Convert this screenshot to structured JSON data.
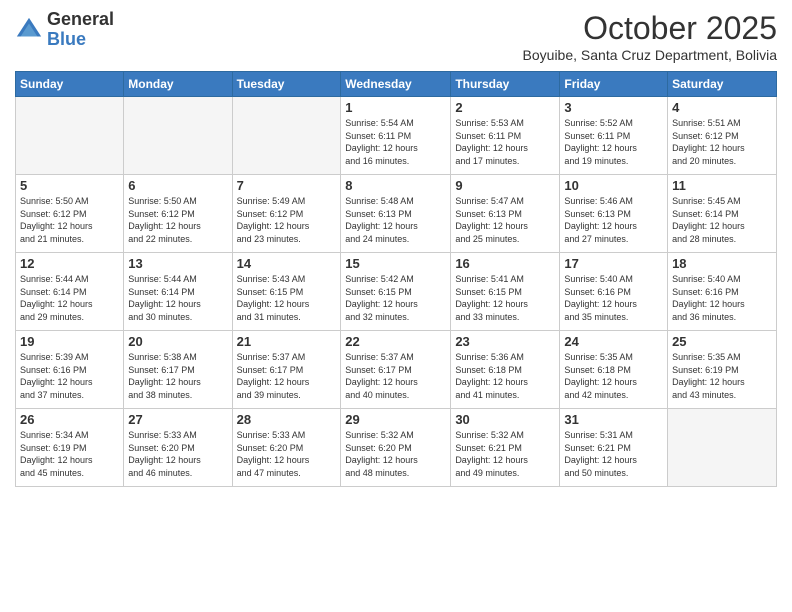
{
  "logo": {
    "general": "General",
    "blue": "Blue"
  },
  "header": {
    "month": "October 2025",
    "location": "Boyuibe, Santa Cruz Department, Bolivia"
  },
  "weekdays": [
    "Sunday",
    "Monday",
    "Tuesday",
    "Wednesday",
    "Thursday",
    "Friday",
    "Saturday"
  ],
  "weeks": [
    [
      {
        "day": "",
        "info": ""
      },
      {
        "day": "",
        "info": ""
      },
      {
        "day": "",
        "info": ""
      },
      {
        "day": "1",
        "info": "Sunrise: 5:54 AM\nSunset: 6:11 PM\nDaylight: 12 hours\nand 16 minutes."
      },
      {
        "day": "2",
        "info": "Sunrise: 5:53 AM\nSunset: 6:11 PM\nDaylight: 12 hours\nand 17 minutes."
      },
      {
        "day": "3",
        "info": "Sunrise: 5:52 AM\nSunset: 6:11 PM\nDaylight: 12 hours\nand 19 minutes."
      },
      {
        "day": "4",
        "info": "Sunrise: 5:51 AM\nSunset: 6:12 PM\nDaylight: 12 hours\nand 20 minutes."
      }
    ],
    [
      {
        "day": "5",
        "info": "Sunrise: 5:50 AM\nSunset: 6:12 PM\nDaylight: 12 hours\nand 21 minutes."
      },
      {
        "day": "6",
        "info": "Sunrise: 5:50 AM\nSunset: 6:12 PM\nDaylight: 12 hours\nand 22 minutes."
      },
      {
        "day": "7",
        "info": "Sunrise: 5:49 AM\nSunset: 6:12 PM\nDaylight: 12 hours\nand 23 minutes."
      },
      {
        "day": "8",
        "info": "Sunrise: 5:48 AM\nSunset: 6:13 PM\nDaylight: 12 hours\nand 24 minutes."
      },
      {
        "day": "9",
        "info": "Sunrise: 5:47 AM\nSunset: 6:13 PM\nDaylight: 12 hours\nand 25 minutes."
      },
      {
        "day": "10",
        "info": "Sunrise: 5:46 AM\nSunset: 6:13 PM\nDaylight: 12 hours\nand 27 minutes."
      },
      {
        "day": "11",
        "info": "Sunrise: 5:45 AM\nSunset: 6:14 PM\nDaylight: 12 hours\nand 28 minutes."
      }
    ],
    [
      {
        "day": "12",
        "info": "Sunrise: 5:44 AM\nSunset: 6:14 PM\nDaylight: 12 hours\nand 29 minutes."
      },
      {
        "day": "13",
        "info": "Sunrise: 5:44 AM\nSunset: 6:14 PM\nDaylight: 12 hours\nand 30 minutes."
      },
      {
        "day": "14",
        "info": "Sunrise: 5:43 AM\nSunset: 6:15 PM\nDaylight: 12 hours\nand 31 minutes."
      },
      {
        "day": "15",
        "info": "Sunrise: 5:42 AM\nSunset: 6:15 PM\nDaylight: 12 hours\nand 32 minutes."
      },
      {
        "day": "16",
        "info": "Sunrise: 5:41 AM\nSunset: 6:15 PM\nDaylight: 12 hours\nand 33 minutes."
      },
      {
        "day": "17",
        "info": "Sunrise: 5:40 AM\nSunset: 6:16 PM\nDaylight: 12 hours\nand 35 minutes."
      },
      {
        "day": "18",
        "info": "Sunrise: 5:40 AM\nSunset: 6:16 PM\nDaylight: 12 hours\nand 36 minutes."
      }
    ],
    [
      {
        "day": "19",
        "info": "Sunrise: 5:39 AM\nSunset: 6:16 PM\nDaylight: 12 hours\nand 37 minutes."
      },
      {
        "day": "20",
        "info": "Sunrise: 5:38 AM\nSunset: 6:17 PM\nDaylight: 12 hours\nand 38 minutes."
      },
      {
        "day": "21",
        "info": "Sunrise: 5:37 AM\nSunset: 6:17 PM\nDaylight: 12 hours\nand 39 minutes."
      },
      {
        "day": "22",
        "info": "Sunrise: 5:37 AM\nSunset: 6:17 PM\nDaylight: 12 hours\nand 40 minutes."
      },
      {
        "day": "23",
        "info": "Sunrise: 5:36 AM\nSunset: 6:18 PM\nDaylight: 12 hours\nand 41 minutes."
      },
      {
        "day": "24",
        "info": "Sunrise: 5:35 AM\nSunset: 6:18 PM\nDaylight: 12 hours\nand 42 minutes."
      },
      {
        "day": "25",
        "info": "Sunrise: 5:35 AM\nSunset: 6:19 PM\nDaylight: 12 hours\nand 43 minutes."
      }
    ],
    [
      {
        "day": "26",
        "info": "Sunrise: 5:34 AM\nSunset: 6:19 PM\nDaylight: 12 hours\nand 45 minutes."
      },
      {
        "day": "27",
        "info": "Sunrise: 5:33 AM\nSunset: 6:20 PM\nDaylight: 12 hours\nand 46 minutes."
      },
      {
        "day": "28",
        "info": "Sunrise: 5:33 AM\nSunset: 6:20 PM\nDaylight: 12 hours\nand 47 minutes."
      },
      {
        "day": "29",
        "info": "Sunrise: 5:32 AM\nSunset: 6:20 PM\nDaylight: 12 hours\nand 48 minutes."
      },
      {
        "day": "30",
        "info": "Sunrise: 5:32 AM\nSunset: 6:21 PM\nDaylight: 12 hours\nand 49 minutes."
      },
      {
        "day": "31",
        "info": "Sunrise: 5:31 AM\nSunset: 6:21 PM\nDaylight: 12 hours\nand 50 minutes."
      },
      {
        "day": "",
        "info": ""
      }
    ]
  ]
}
